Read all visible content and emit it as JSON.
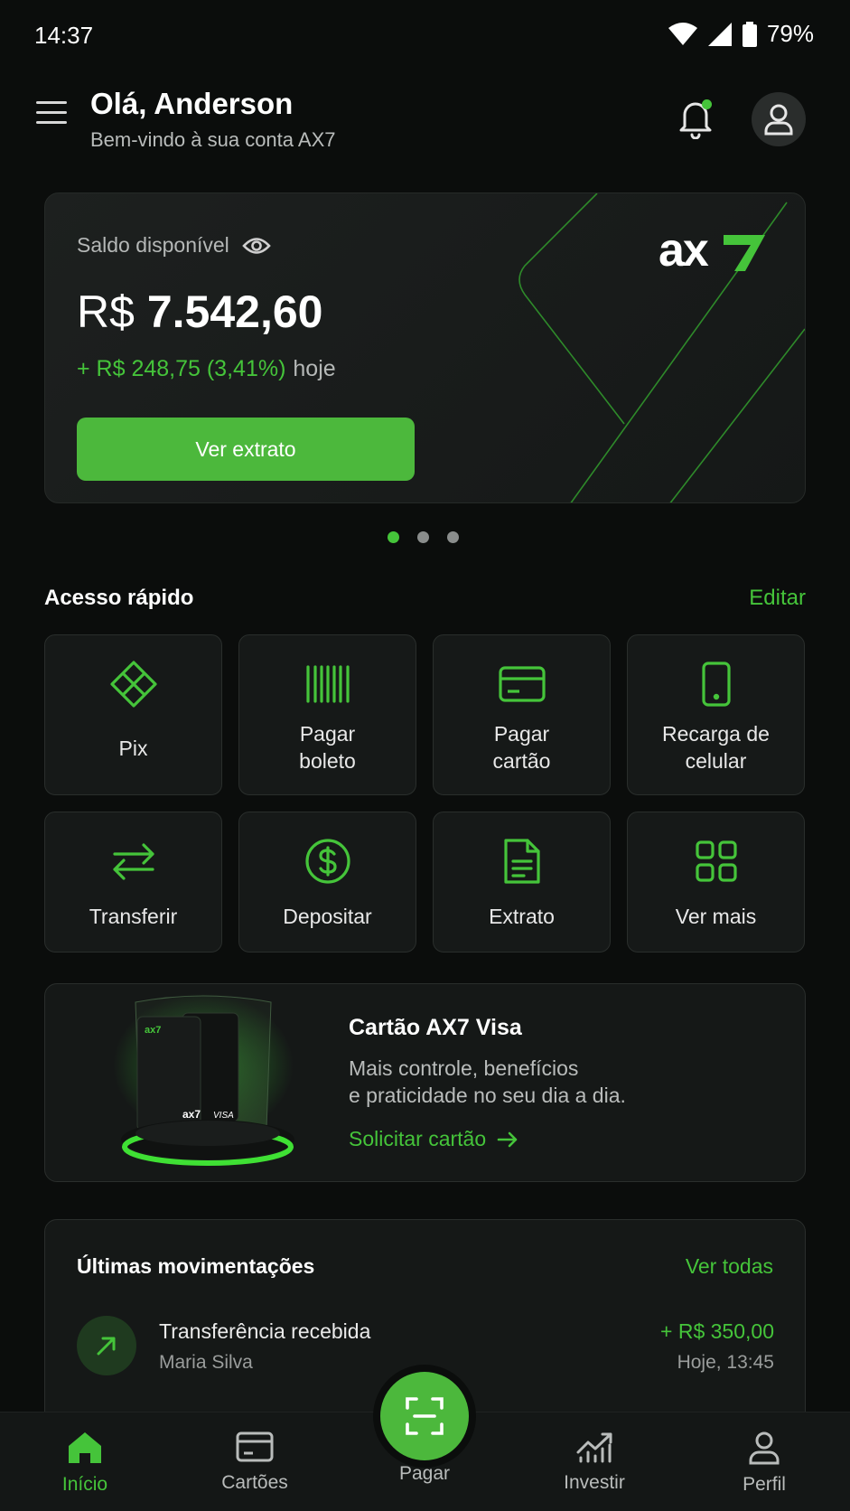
{
  "status_bar": {
    "time": "14:37",
    "battery": "79%"
  },
  "header": {
    "greeting": "Olá, Anderson",
    "subtitle": "Bem-vindo à sua conta AX7"
  },
  "balance": {
    "label": "Saldo disponível",
    "currency": "R$",
    "amount": "7.542,60",
    "change": "+ R$ 248,75 (3,41%)",
    "change_period": "hoje",
    "button": "Ver extrato",
    "brand_logo_text": "ax7",
    "carousel": {
      "pages": 3,
      "active": 1
    }
  },
  "quick_access": {
    "title": "Acesso rápido",
    "edit": "Editar",
    "row1": [
      {
        "label": "Pix",
        "icon": "pix-icon"
      },
      {
        "label": "Pagar\nboleto",
        "icon": "barcode-icon"
      },
      {
        "label": "Pagar\ncartão",
        "icon": "credit-card-icon"
      },
      {
        "label": "Recarga de\ncelular",
        "icon": "smartphone-icon"
      }
    ],
    "row2": [
      {
        "label": "Transferir",
        "icon": "transfer-arrows-icon"
      },
      {
        "label": "Depositar",
        "icon": "dollar-circle-icon"
      },
      {
        "label": "Extrato",
        "icon": "document-icon"
      },
      {
        "label": "Ver mais",
        "icon": "grid-icon"
      }
    ]
  },
  "promo": {
    "title": "Cartão AX7 Visa",
    "line1": "Mais controle, benefícios",
    "line2": "e praticidade no seu dia a dia.",
    "link": "Solicitar cartão"
  },
  "movements": {
    "title": "Últimas movimentações",
    "see_all": "Ver todas",
    "items": [
      {
        "name": "Transferência recebida",
        "counterparty": "Maria Silva",
        "amount": "+ R$ 350,00",
        "time": "Hoje, 13:45"
      }
    ]
  },
  "bottom_nav": {
    "items": [
      {
        "label": "Início",
        "icon": "home-icon",
        "active": true
      },
      {
        "label": "Cartões",
        "icon": "card-icon",
        "active": false
      },
      {
        "label": "Pagar",
        "icon": "scan-icon",
        "active": false
      },
      {
        "label": "Investir",
        "icon": "chart-icon",
        "active": false
      },
      {
        "label": "Perfil",
        "icon": "user-icon",
        "active": false
      }
    ]
  },
  "colors": {
    "accent": "#45c43a",
    "button": "#4cb83c",
    "background": "#0b0d0c",
    "card": "#151817"
  }
}
